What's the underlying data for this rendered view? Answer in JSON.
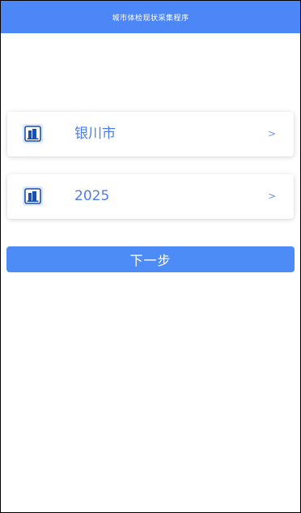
{
  "header": {
    "title": "城市体检现状采集程序",
    "background_color": "#4d86f7"
  },
  "selectors": [
    {
      "icon": "building-icon",
      "value": "银川市",
      "chevron": ">"
    },
    {
      "icon": "building-icon",
      "value": "2025",
      "chevron": ">"
    }
  ],
  "next_button": {
    "label": "下一步",
    "color": "#4d8cf7"
  }
}
